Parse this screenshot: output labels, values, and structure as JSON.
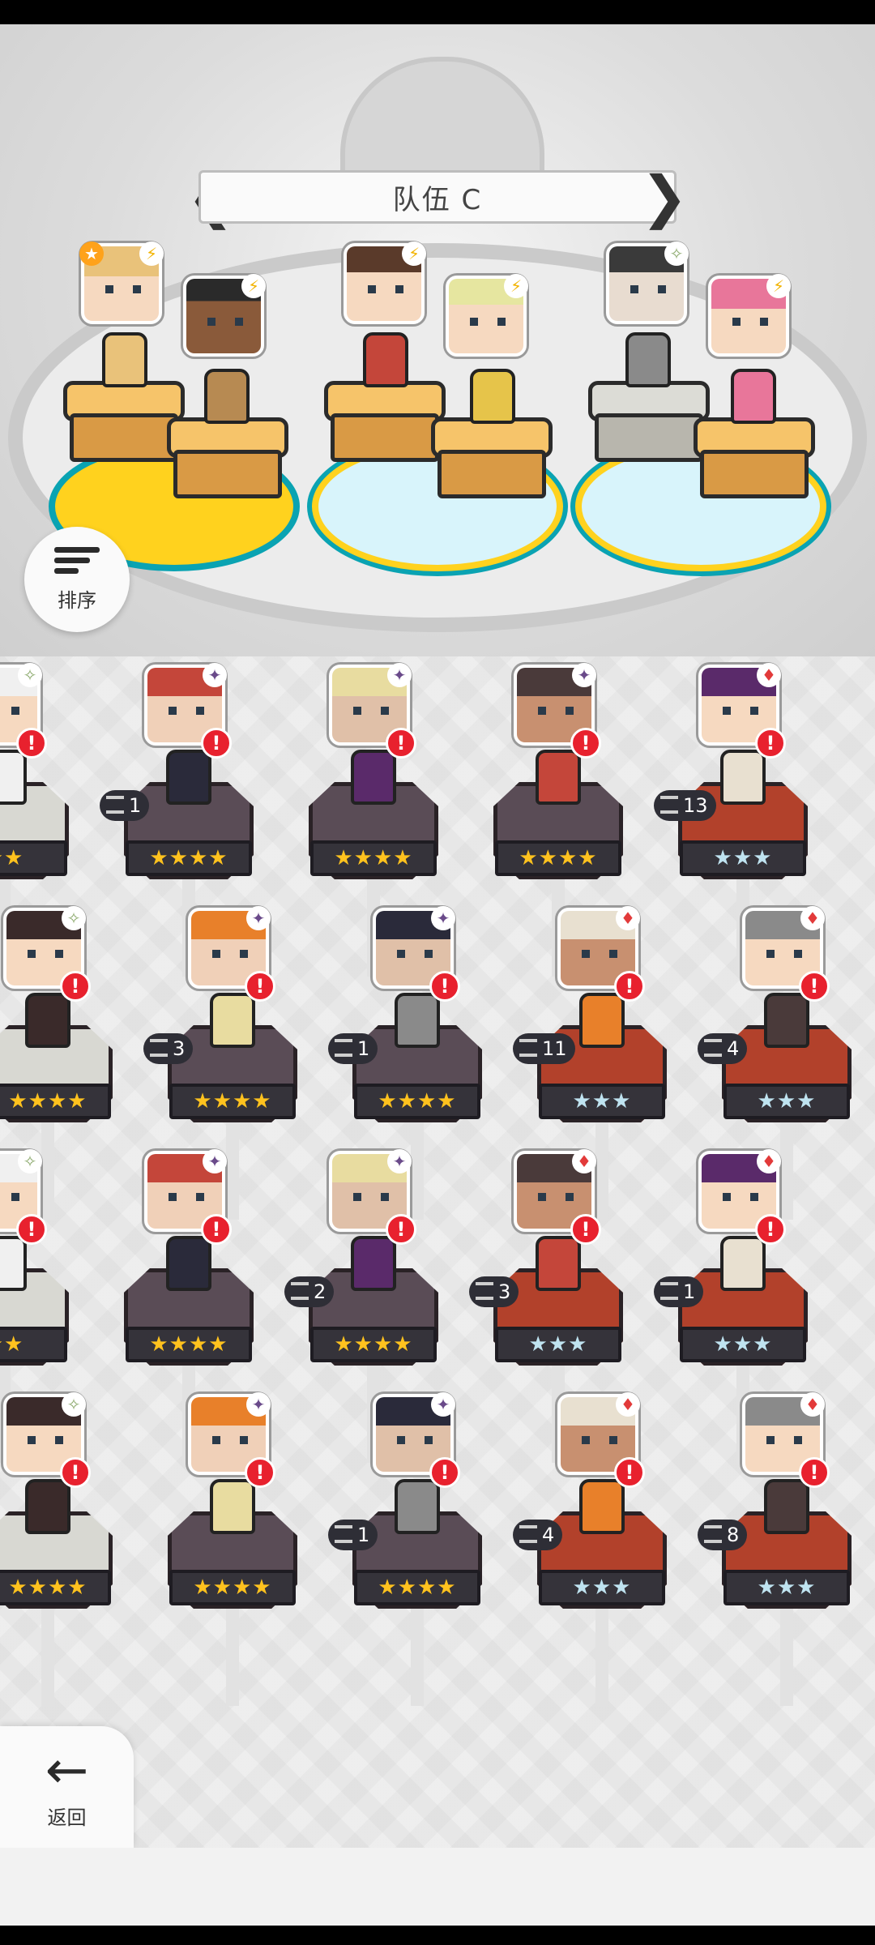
{
  "team": {
    "title": "队伍 C",
    "prev_arrow": "❮",
    "next_arrow": "❯"
  },
  "controls": {
    "sort_label": "排序",
    "back_label": "返回",
    "back_arrow": "←"
  },
  "icons": {
    "alert": "!",
    "bolt": "⚡",
    "star": "★",
    "sparkle": "✧",
    "diamond": "♦",
    "moon": "✦"
  },
  "colors": {
    "pad_yellow": "#ffd21e",
    "pad_cyan": "#d8f4fb",
    "pad_border": "#0aa3b2",
    "alert_red": "#e8212e",
    "pedestal_purple": "#5a4c56",
    "pedestal_red": "#b2412b",
    "pedestal_white": "#d8d8d2"
  },
  "roster": [
    {
      "row": 0,
      "col": 0,
      "stars": "★★",
      "tier": "gold",
      "base": "white",
      "level": "",
      "badge": "sparkle"
    },
    {
      "row": 0,
      "col": 1,
      "stars": "★★★★",
      "tier": "gold",
      "base": "purple",
      "level": "1",
      "badge": "moon"
    },
    {
      "row": 0,
      "col": 2,
      "stars": "★★★★",
      "tier": "gold",
      "base": "purple",
      "level": "",
      "badge": "moon"
    },
    {
      "row": 0,
      "col": 3,
      "stars": "★★★★",
      "tier": "gold",
      "base": "purple",
      "level": "",
      "badge": "moon"
    },
    {
      "row": 0,
      "col": 4,
      "stars": "★★★",
      "tier": "silver",
      "base": "red",
      "level": "13",
      "badge": "diamond"
    },
    {
      "row": 1,
      "col": 0,
      "stars": "★★★★",
      "tier": "gold",
      "base": "white",
      "level": "",
      "badge": "sparkle"
    },
    {
      "row": 1,
      "col": 1,
      "stars": "★★★★",
      "tier": "gold",
      "base": "purple",
      "level": "3",
      "badge": "moon"
    },
    {
      "row": 1,
      "col": 2,
      "stars": "★★★★",
      "tier": "gold",
      "base": "purple",
      "level": "1",
      "badge": "moon"
    },
    {
      "row": 1,
      "col": 3,
      "stars": "★★★",
      "tier": "silver",
      "base": "red",
      "level": "11",
      "badge": "diamond"
    },
    {
      "row": 1,
      "col": 4,
      "stars": "★★★",
      "tier": "silver",
      "base": "red",
      "level": "4",
      "badge": "diamond"
    },
    {
      "row": 2,
      "col": 0,
      "stars": "★★",
      "tier": "gold",
      "base": "white",
      "level": "",
      "badge": "sparkle"
    },
    {
      "row": 2,
      "col": 1,
      "stars": "★★★★",
      "tier": "gold",
      "base": "purple",
      "level": "",
      "badge": "moon"
    },
    {
      "row": 2,
      "col": 2,
      "stars": "★★★★",
      "tier": "gold",
      "base": "purple",
      "level": "2",
      "badge": "moon"
    },
    {
      "row": 2,
      "col": 3,
      "stars": "★★★",
      "tier": "silver",
      "base": "red",
      "level": "3",
      "badge": "diamond"
    },
    {
      "row": 2,
      "col": 4,
      "stars": "★★★",
      "tier": "silver",
      "base": "red",
      "level": "1",
      "badge": "diamond"
    },
    {
      "row": 3,
      "col": 0,
      "stars": "★★★★",
      "tier": "gold",
      "base": "white",
      "level": "",
      "badge": "sparkle"
    },
    {
      "row": 3,
      "col": 1,
      "stars": "★★★★",
      "tier": "gold",
      "base": "purple",
      "level": "",
      "badge": "moon"
    },
    {
      "row": 3,
      "col": 2,
      "stars": "★★★★",
      "tier": "gold",
      "base": "purple",
      "level": "1",
      "badge": "moon"
    },
    {
      "row": 3,
      "col": 3,
      "stars": "★★★",
      "tier": "silver",
      "base": "red",
      "level": "4",
      "badge": "diamond"
    },
    {
      "row": 3,
      "col": 4,
      "stars": "★★★",
      "tier": "silver",
      "base": "red",
      "level": "8",
      "badge": "diamond"
    }
  ]
}
